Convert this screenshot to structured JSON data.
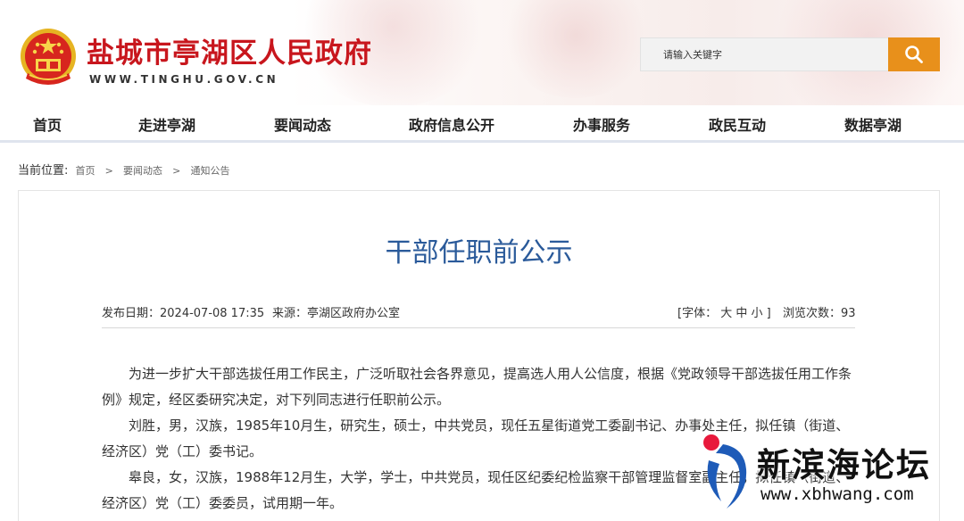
{
  "header": {
    "site_title": "盐城市亭湖区人民政府",
    "site_url": "WWW.TINGHU.GOV.CN",
    "search_placeholder": "请输入关键字"
  },
  "nav": {
    "items": [
      "首页",
      "走进亭湖",
      "要闻动态",
      "政府信息公开",
      "办事服务",
      "政民互动",
      "数据亭湖"
    ]
  },
  "breadcrumb": {
    "label": "当前位置:",
    "items": [
      "首页",
      "要闻动态",
      "通知公告"
    ],
    "separator": ">"
  },
  "article": {
    "title": "干部任职前公示",
    "publish_date": "发布日期：2024-07-08 17:35",
    "source": "来源：亭湖区政府办公室",
    "font_size_control": "[字体：  大  中  小  ]",
    "views": "浏览次数：93",
    "paragraphs": [
      "为进一步扩大干部选拔任用工作民主，广泛听取社会各界意见，提高选人用人公信度，根据《党政领导干部选拔任用工作条例》规定，经区委研究决定，对下列同志进行任职前公示。",
      "刘胜，男，汉族，1985年10月生，研究生，硕士，中共党员，现任五星街道党工委副书记、办事处主任，拟任镇（街道、经济区）党（工）委书记。",
      "皋良，女，汉族，1988年12月生，大学，学士，中共党员，现任区纪委纪检监察干部管理监督室副主任，拟任镇（街道、经济区）党（工）委委员，试用期一年。"
    ]
  },
  "watermark": {
    "name": "新滨海论坛",
    "url": "www.xbhwang.com"
  },
  "colors": {
    "brand_red": "#c8161d",
    "search_button": "#e8901b",
    "title_blue": "#2a5a9a"
  }
}
